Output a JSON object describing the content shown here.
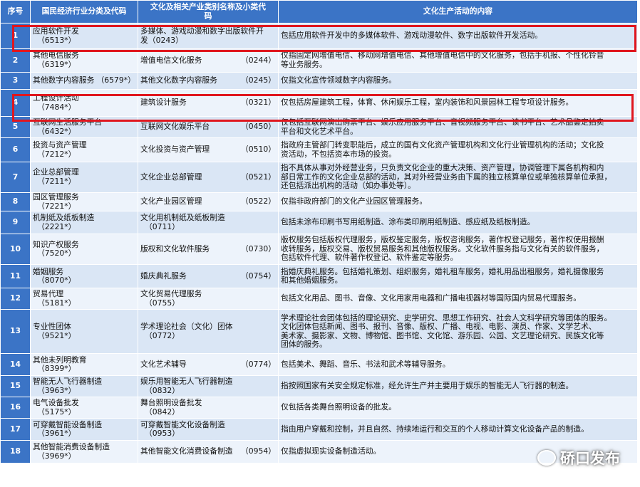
{
  "headers": {
    "no": "序号",
    "industry": "国民经济行业分类及代码",
    "culture_line1": "文化及相关产业类别名称及小类代",
    "culture_line2": "码",
    "activity": "文化生产活动的内容"
  },
  "rows": [
    {
      "no": "1",
      "ind": "应用软件开发",
      "ind_code": "（6513*）",
      "cul": "多媒体、游戏动漫和数字出版软件开",
      "cul_code": "发（0243）",
      "desc": [
        "包括应用软件开发中的多媒体软件、游戏动漫软件、数字出版软件开发活动。"
      ]
    },
    {
      "no": "2",
      "ind": "其他电信服务",
      "ind_code": "（6319*）",
      "cul": "增值电信文化服务",
      "cul_code": "（0244）",
      "desc": [
        "仅指固定网增值电信、移动网增值电信、其他增值电信中的文化服务，包括手机报、个性化铃音",
        "等业务服务。"
      ]
    },
    {
      "no": "3",
      "ind": "其他数字内容服务",
      "ind_code": "（6579*）",
      "cul": "其他文化数字内容服务",
      "cul_code": "（0245）",
      "desc": [
        "仅指文化宣传领域数字内容服务。"
      ]
    },
    {
      "no": "4",
      "ind": "工程设计活动",
      "ind_code": "（7484*）",
      "cul": "建筑设计服务",
      "cul_code": "（0321）",
      "desc": [
        "仅包括房屋建筑工程，体育、休闲娱乐工程，室内装饰和风景园林工程专项设计服务。"
      ]
    },
    {
      "no": "5",
      "ind": "互联网生活服务平台",
      "ind_code": "（6432*）",
      "cul": "互联网文化娱乐平台",
      "cul_code": "（0450）",
      "desc": [
        "仅包括互联网演出购票平台、娱乐应用服务平台、音视频服务平台、读书平台、艺术品鉴定拍卖",
        "平台和文化艺术平台。"
      ]
    },
    {
      "no": "6",
      "ind": "投资与资产管理",
      "ind_code": "（7212*）",
      "cul": "文化投资与资产管理",
      "cul_code": "（0510）",
      "desc": [
        "指政府主管部门转变职能后，成立的国有文化资产管理机构和文化行业管理机构的活动；文化投",
        "资活动，不包括资本市场的投资。"
      ]
    },
    {
      "no": "7",
      "ind": "企业总部管理",
      "ind_code": "（7211*）",
      "cul": "文化企业总部管理",
      "cul_code": "（0521）",
      "desc": [
        "指不具体从事对外经营业务，只负责文化企业的重大决策、资产管理，协调管理下属各机构和内",
        "部日常工作的文化企业总部的活动，其对外经营业务由下属的独立核算单位或单独核算单位承担，",
        "还包括派出机构的活动（如办事处等）。"
      ]
    },
    {
      "no": "8",
      "ind": "园区管理服务",
      "ind_code": "（7221*）",
      "cul": "文化产业园区管理",
      "cul_code": "（0522）",
      "desc": [
        "仅指非政府部门的文化产业园区管理服务。"
      ]
    },
    {
      "no": "9",
      "ind": "机制纸及纸板制造",
      "ind_code": "（2221*）",
      "cul": "文化用机制纸及纸板制造",
      "cul_code": "（0711）",
      "desc": [
        "包括未涂布印刷书写用纸制造、涂布类印刷用纸制造、感应纸及纸板制造。"
      ]
    },
    {
      "no": "10",
      "ind": "知识产权服务",
      "ind_code": "（7520*）",
      "cul": "版权和文化软件服务",
      "cul_code": "（0730）",
      "desc": [
        "版权服务包括版权代理服务，版权鉴定服务，版权咨询服务，著作权登记服务，著作权使用报酬",
        "收转服务，版权交易、版权贸易服务和其他版权服务。文化软件服务指与文化有关的软件服务，",
        "包括软件代理、软件著作权登记、软件鉴定等服务。"
      ]
    },
    {
      "no": "11",
      "ind": "婚姻服务",
      "ind_code": "（8070*）",
      "cul": "婚庆典礼服务",
      "cul_code": "（0754）",
      "desc": [
        "指婚庆典礼服务。包括婚礼策划、组织服务，婚礼租车服务，婚礼用品出租服务，婚礼摄像服务",
        "和其他婚姻服务。"
      ]
    },
    {
      "no": "12",
      "ind": "贸易代理",
      "ind_code": "（5181*）",
      "cul": "文化贸易代理服务",
      "cul_code": "（0755）",
      "desc": [
        "包括文化用品、图书、音像、文化用家用电器和广播电视器材等国际国内贸易代理服务。"
      ]
    },
    {
      "no": "13",
      "ind": "专业性团体",
      "ind_code": "（9521*）",
      "cul": "学术理论社会（文化）团体",
      "cul_code": "（0772）",
      "desc": [
        "学术理论社会团体包括的理论研究、史学研究、思想工作研究、社会人文科学研究等团体的服务。",
        "文化团体包括新闻、图书、报刊、音像、版权、广播、电视、电影、演员、作家、文学艺术、",
        "美术家、摄影家、文物、博物馆、图书馆、文化馆、游乐园、公园、文艺理论研究、民族文化等",
        "团体的服务。"
      ]
    },
    {
      "no": "14",
      "ind": "其他未列明教育",
      "ind_code": "（8399*）",
      "cul": "文化艺术辅导",
      "cul_code": "（0774）",
      "desc": [
        "包括美术、舞蹈、音乐、书法和武术等辅导服务。"
      ]
    },
    {
      "no": "15",
      "ind": "智能无人飞行器制造",
      "ind_code": "（3963*）",
      "cul": "娱乐用智能无人飞行器制造",
      "cul_code": "（0832）",
      "desc": [
        "指按照国家有关安全规定标准，经允许生产并主要用于娱乐的智能无人飞行器的制造。"
      ]
    },
    {
      "no": "16",
      "ind": "电气设备批发",
      "ind_code": "（5175*）",
      "cul": "舞台照明设备批发",
      "cul_code": "（0842）",
      "desc": [
        "仅包括各类舞台照明设备的批发。"
      ]
    },
    {
      "no": "17",
      "ind": "可穿戴智能设备制造",
      "ind_code": "（3961*）",
      "cul": "可穿戴智能文化设备制造",
      "cul_code": "（0953）",
      "desc": [
        "指由用户穿戴和控制，并且自然、持续地运行和交互的个人移动计算文化设备产品的制造。"
      ]
    },
    {
      "no": "18",
      "ind": "其他智能消费设备制造",
      "ind_code": "（3969*）",
      "cul": "其他智能文化消费设备制造",
      "cul_code": "（0954）",
      "desc": [
        "仅指虚拟现实设备制造活动。"
      ]
    }
  ],
  "watermark": "硚口发布",
  "colors": {
    "header_blue": "#3b74c6",
    "row_light": "#dae6f5",
    "row_lighter": "#edf3fb",
    "highlight_red": "#e0161e"
  }
}
